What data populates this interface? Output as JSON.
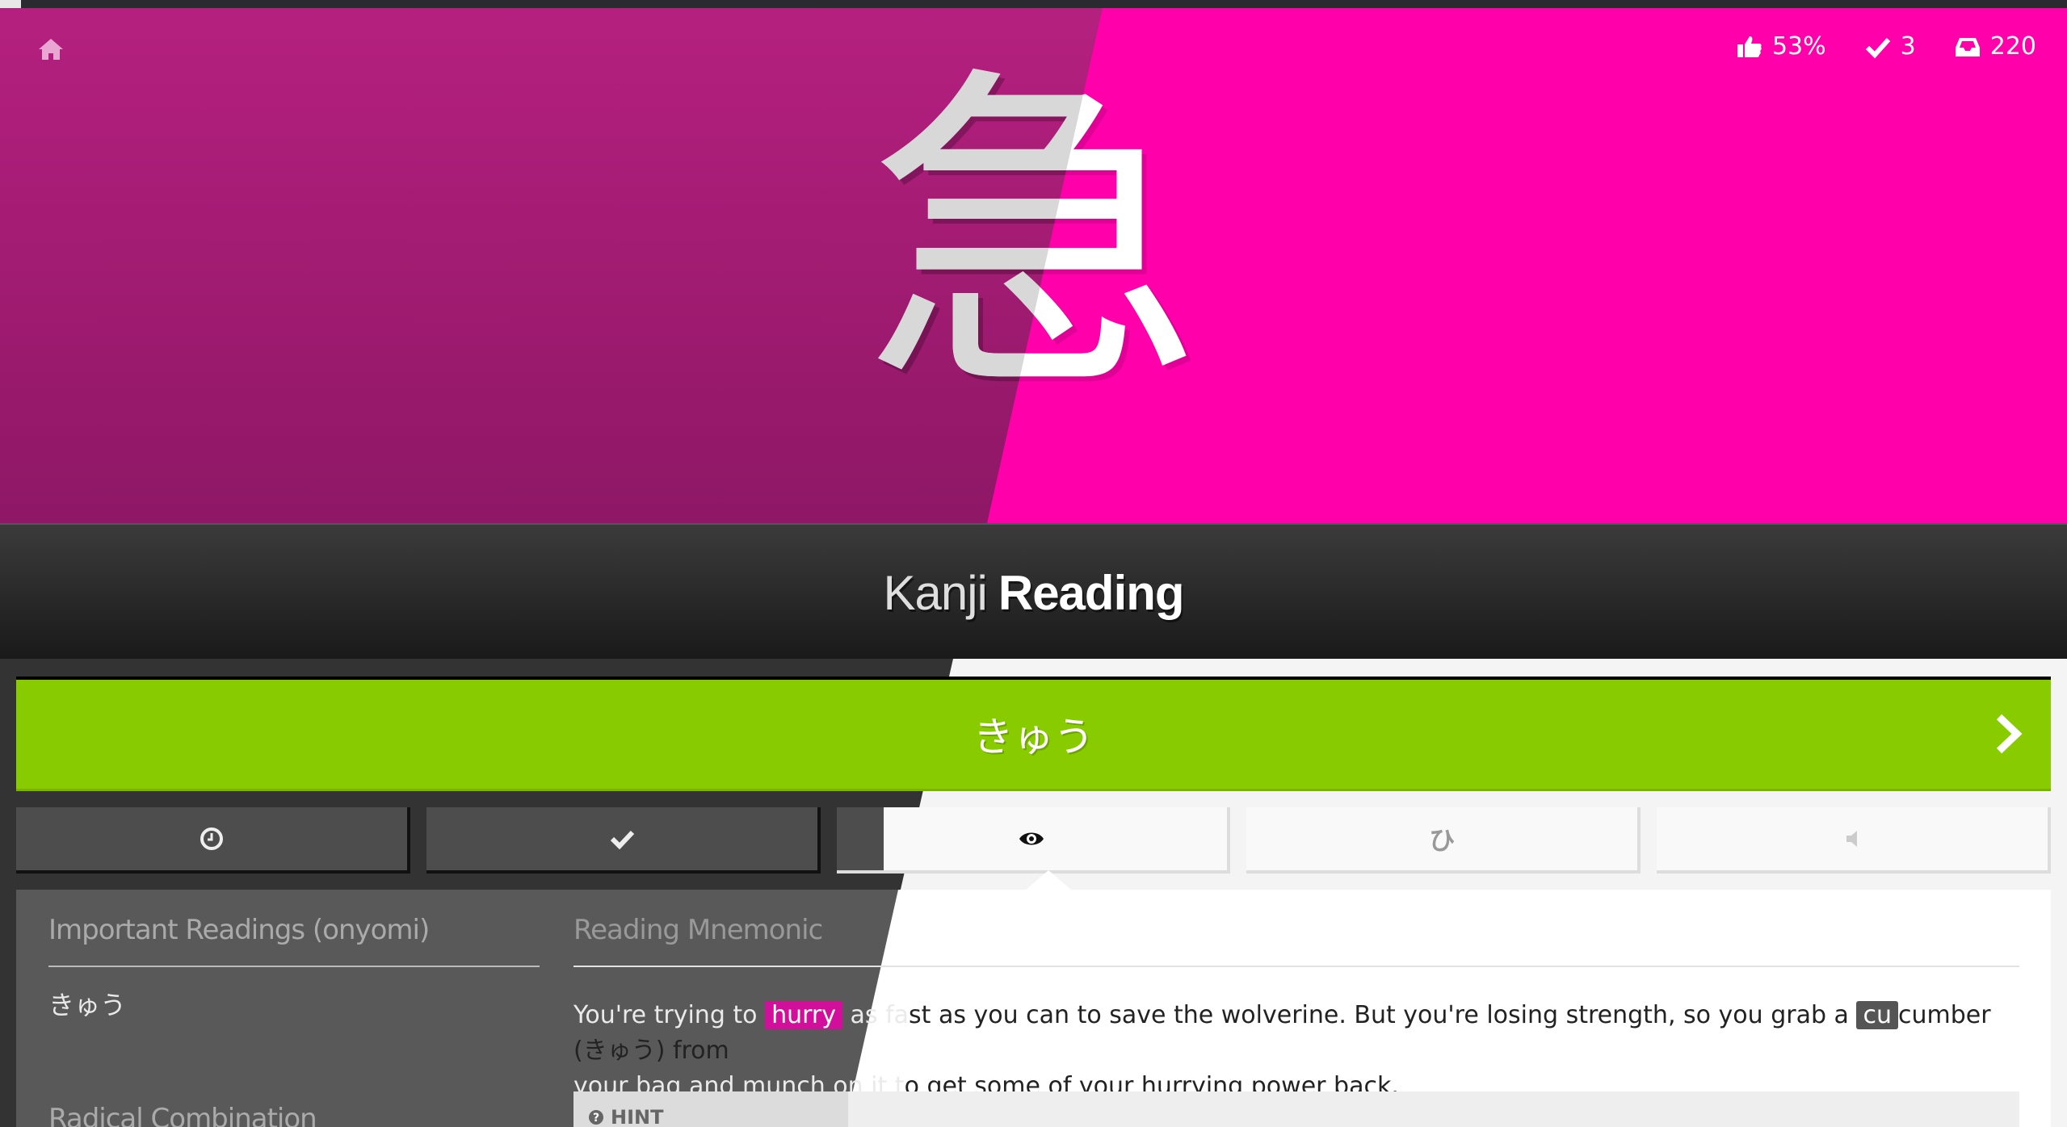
{
  "progress": {
    "fraction": 0.01
  },
  "hero": {
    "kanji": "急",
    "stats": [
      {
        "icon": "thumbs-up-icon",
        "value": "53%"
      },
      {
        "icon": "check-icon",
        "value": "3"
      },
      {
        "icon": "inbox-icon",
        "value": "220"
      }
    ]
  },
  "section": {
    "type_label": "Kanji",
    "mode_label": "Reading"
  },
  "answer": {
    "value": "きゅう"
  },
  "tabs": [
    {
      "icon": "clock-icon",
      "name": "tab-previous"
    },
    {
      "icon": "check-icon",
      "name": "tab-correct"
    },
    {
      "icon": "eye-icon",
      "name": "tab-item-info"
    },
    {
      "icon": "hiragana-icon",
      "name": "tab-kana"
    },
    {
      "icon": "audio-icon",
      "name": "tab-audio"
    }
  ],
  "tab_kana_glyph": "ひ",
  "info": {
    "important_readings_heading": "Important Readings (onyomi)",
    "important_readings_value": "きゅう",
    "radical_heading": "Radical Combination",
    "mnemonic_heading": "Reading Mnemonic",
    "mnemonic": {
      "t1": "You're trying to ",
      "hl1": "hurry",
      "t2": " as fa",
      "t3": "st as you can to save the wolverine. But you're losing strength, so you grab a ",
      "hl2": "cu",
      "t4": "cumber (きゅう) from",
      "t5": "your bag and munch on it t",
      "t6": "o get some of your hurrying power back."
    },
    "hint_label": "HINT"
  },
  "colors": {
    "pink": "#ff00aa",
    "dark_pink": "#a11a73",
    "green": "#88cc00"
  }
}
